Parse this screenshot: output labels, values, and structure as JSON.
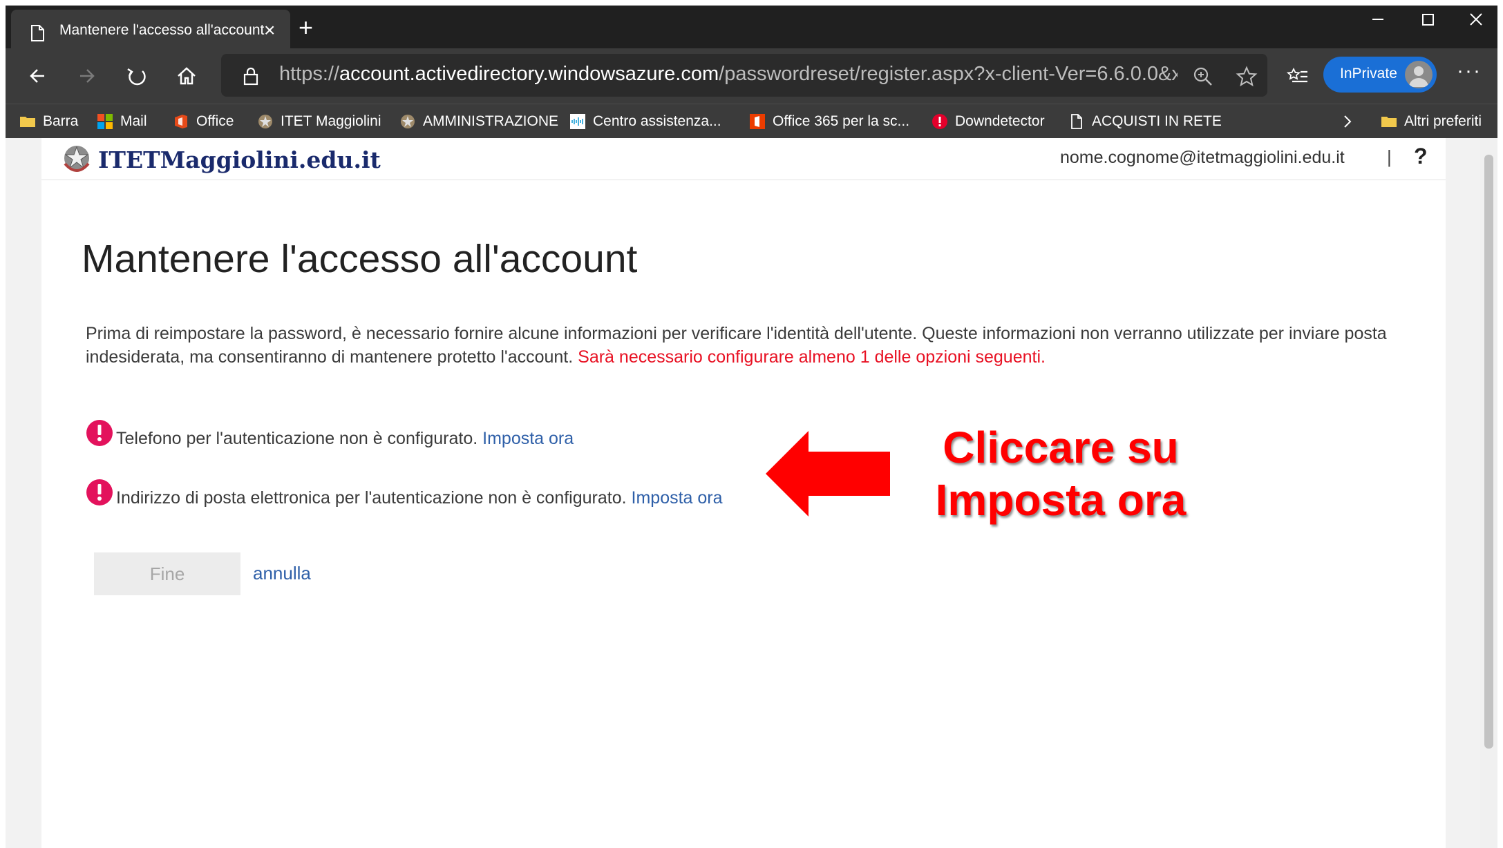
{
  "browser": {
    "tab": {
      "title": "Mantenere l'accesso all'account"
    },
    "address": {
      "scheme": "https://",
      "host": "account.activedirectory.windowsazure.com",
      "path": "/passwordreset/register.aspx?x-client-Ver=6.6.0.0&x-clie..."
    },
    "profile_label": "InPrivate",
    "more_label": "···",
    "favorites": [
      {
        "label": "Barra",
        "icon": "folder-icon"
      },
      {
        "label": "Mail",
        "icon": "microsoft-logo-icon"
      },
      {
        "label": "Office",
        "icon": "office-icon"
      },
      {
        "label": "ITET Maggiolini",
        "icon": "emblem-icon"
      },
      {
        "label": "AMMINISTRAZIONE",
        "icon": "emblem-icon"
      },
      {
        "label": "Centro assistenza...",
        "icon": "cisco-icon"
      },
      {
        "label": "Office 365 per la sc...",
        "icon": "office365-icon"
      },
      {
        "label": "Downdetector",
        "icon": "alert-icon"
      },
      {
        "label": "ACQUISTI IN RETE",
        "icon": "page-icon"
      }
    ],
    "other_favorites": "Altri preferiti"
  },
  "page": {
    "logo_text": "ITETMaggiolini.edu.it",
    "user_email": "nome.cognome@itetmaggiolini.edu.it",
    "separator": "|",
    "help_label": "?",
    "title": "Mantenere l'accesso all'account",
    "intro": "Prima di reimpostare la password, è necessario fornire alcune informazioni per verificare l'identità dell'utente. Queste informazioni non verranno utilizzate per inviare posta indesiderata, ma consentiranno di mantenere protetto l'account.",
    "intro_required": "Sarà necessario configurare almeno 1 delle opzioni seguenti.",
    "items": [
      {
        "text": "Telefono per l'autenticazione non è configurato.",
        "link": "Imposta ora"
      },
      {
        "text": "Indirizzo di posta elettronica per l'autenticazione non è configurato.",
        "link": "Imposta ora"
      }
    ],
    "finish_label": "Fine",
    "cancel_label": "annulla"
  },
  "annotation": {
    "line1": "Cliccare su",
    "line2": "Imposta ora",
    "color": "#ff0000"
  },
  "colors": {
    "accent_link": "#2e5fa8",
    "required_text": "#e81123",
    "alert_badge": "#e3125c",
    "inprivate": "#1a6fd6"
  }
}
